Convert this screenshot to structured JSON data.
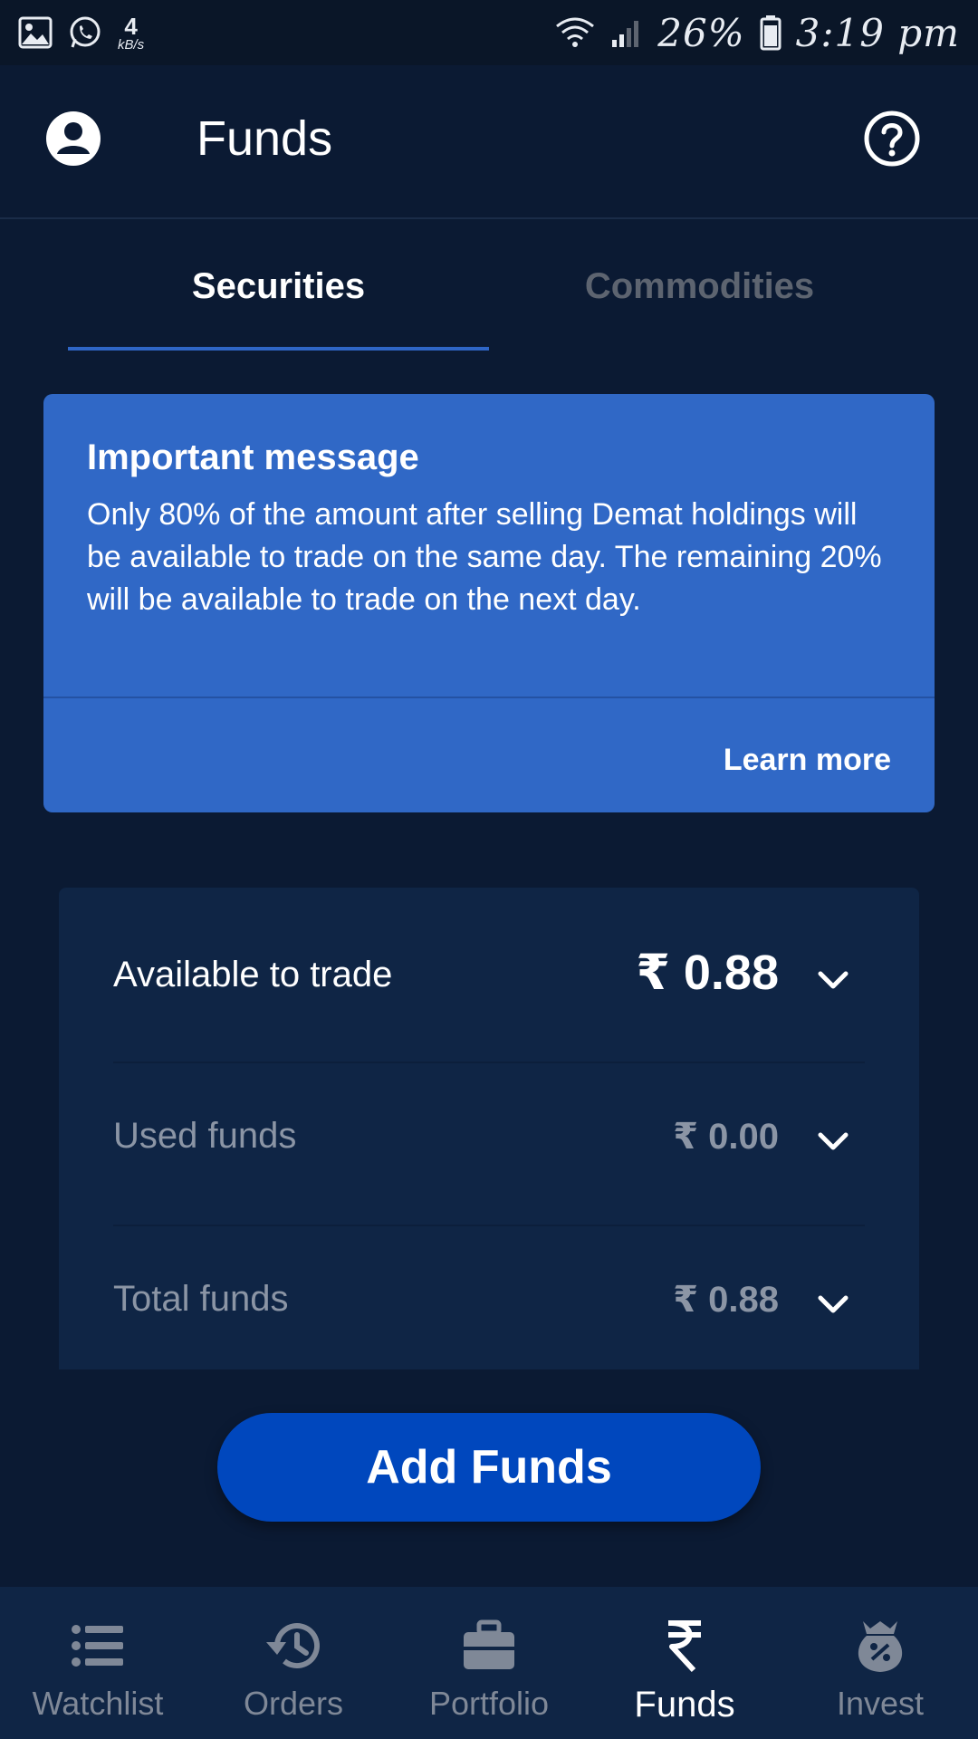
{
  "status_bar": {
    "net_speed_value": "4",
    "net_speed_unit": "kB/s",
    "battery": "26%",
    "time": "3:19 pm"
  },
  "header": {
    "title": "Funds"
  },
  "tabs": [
    {
      "label": "Securities",
      "active": true
    },
    {
      "label": "Commodities",
      "active": false
    }
  ],
  "message": {
    "title": "Important message",
    "body": "Only 80% of the amount after selling Demat holdings will be available to trade on the same day. The remaining 20% will be available to trade on the next day.",
    "link": "Learn more"
  },
  "funds": [
    {
      "label": "Available to trade",
      "value": "₹ 0.88"
    },
    {
      "label": "Used funds",
      "value": "₹ 0.00"
    },
    {
      "label": "Total funds",
      "value": "₹ 0.88"
    }
  ],
  "add_funds_label": "Add Funds",
  "bottom_nav": [
    {
      "label": "Watchlist",
      "icon": "list-icon",
      "active": false
    },
    {
      "label": "Orders",
      "icon": "history-icon",
      "active": false
    },
    {
      "label": "Portfolio",
      "icon": "briefcase-icon",
      "active": false
    },
    {
      "label": "Funds",
      "icon": "rupee-icon",
      "active": true
    },
    {
      "label": "Invest",
      "icon": "money-bag-icon",
      "active": false
    }
  ],
  "colors": {
    "background": "#0b1a33",
    "card": "#3068c6",
    "accent": "#0047bd",
    "panel": "#0f2545"
  }
}
